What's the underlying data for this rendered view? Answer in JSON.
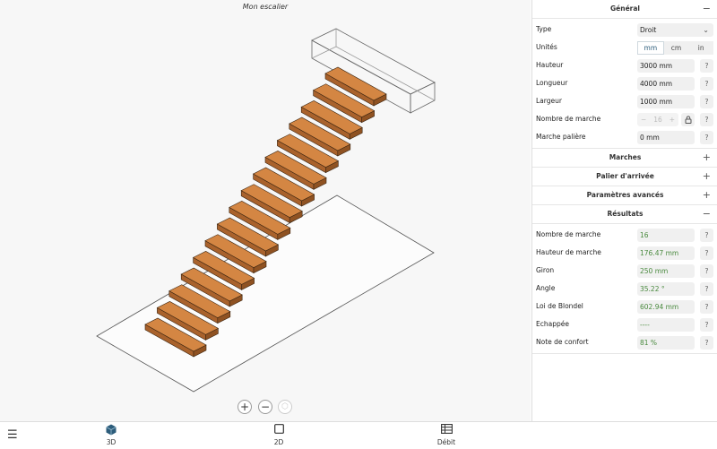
{
  "project": {
    "title": "Mon escalier"
  },
  "viewport": {
    "zoom_in": "+",
    "zoom_out": "−",
    "reset_view": "⬡",
    "tread_color": "#d48643"
  },
  "bottom_tabs": [
    {
      "label": "3D",
      "icon": "cube-icon",
      "active": true
    },
    {
      "label": "2D",
      "icon": "square-icon",
      "active": false
    },
    {
      "label": "Débit",
      "icon": "table-icon",
      "active": false
    }
  ],
  "menu_icon": "hamburger-menu-icon",
  "panel": {
    "general": {
      "title": "Général",
      "toggle": "−",
      "type": {
        "label": "Type",
        "value": "Droit"
      },
      "units": {
        "label": "Unités",
        "options": [
          "mm",
          "cm",
          "in"
        ],
        "selected": "mm"
      },
      "hauteur": {
        "label": "Hauteur",
        "value": "3000 mm"
      },
      "longueur": {
        "label": "Longueur",
        "value": "4000 mm"
      },
      "largeur": {
        "label": "Largeur",
        "value": "1000 mm"
      },
      "nb_marche": {
        "label": "Nombre de marche",
        "minus": "−",
        "value": "16",
        "plus": "+"
      },
      "marche_paliere": {
        "label": "Marche palière",
        "value": "0 mm"
      },
      "help": "?"
    },
    "marches": {
      "title": "Marches",
      "toggle": "+"
    },
    "palier": {
      "title": "Palier d'arrivée",
      "toggle": "+"
    },
    "avances": {
      "title": "Paramètres avancés",
      "toggle": "+"
    },
    "resultats": {
      "title": "Résultats",
      "toggle": "−",
      "rows": [
        {
          "label": "Nombre de marche",
          "value": "16"
        },
        {
          "label": "Hauteur de marche",
          "value": "176.47 mm"
        },
        {
          "label": "Giron",
          "value": "250 mm"
        },
        {
          "label": "Angle",
          "value": "35.22 °"
        },
        {
          "label": "Loi de Blondel",
          "value": "602.94 mm"
        },
        {
          "label": "Echappée",
          "value": "----"
        },
        {
          "label": "Note de confort",
          "value": "81 %"
        }
      ]
    }
  }
}
